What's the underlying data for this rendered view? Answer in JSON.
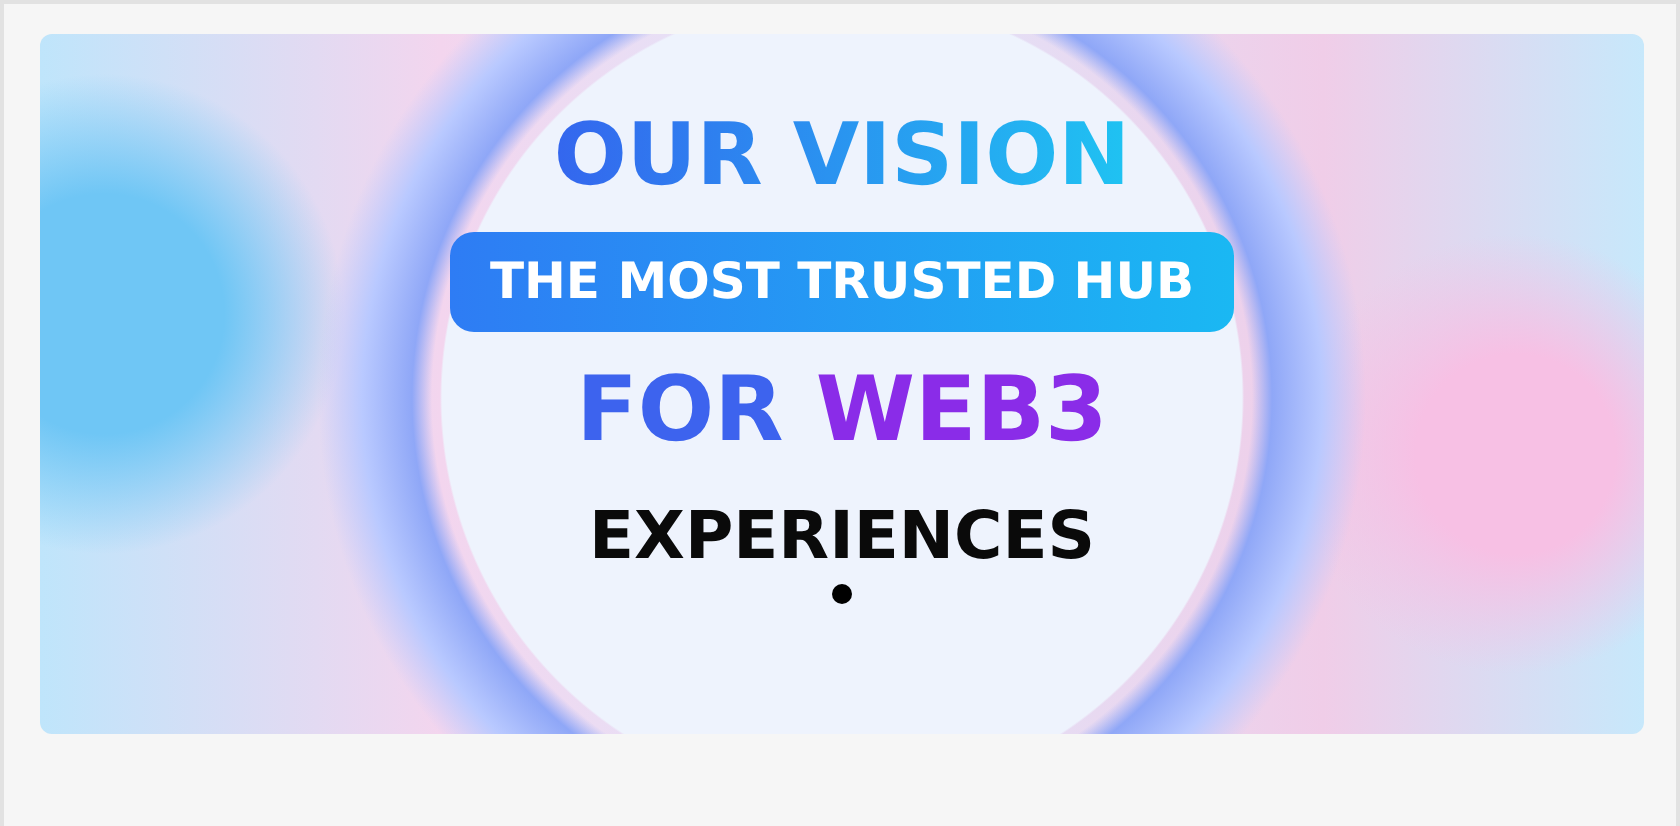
{
  "banner": {
    "headline": "OUR VISION",
    "tagline": "THE MOST TRUSTED HUB",
    "highlight": [
      {
        "text": "FOR",
        "color": "#3d63ee"
      },
      {
        "text": "WEB3",
        "color": "#8a2ce8"
      }
    ],
    "closing": "EXPERIENCES"
  },
  "carousel_indicators": [
    {
      "selected": true
    }
  ]
}
